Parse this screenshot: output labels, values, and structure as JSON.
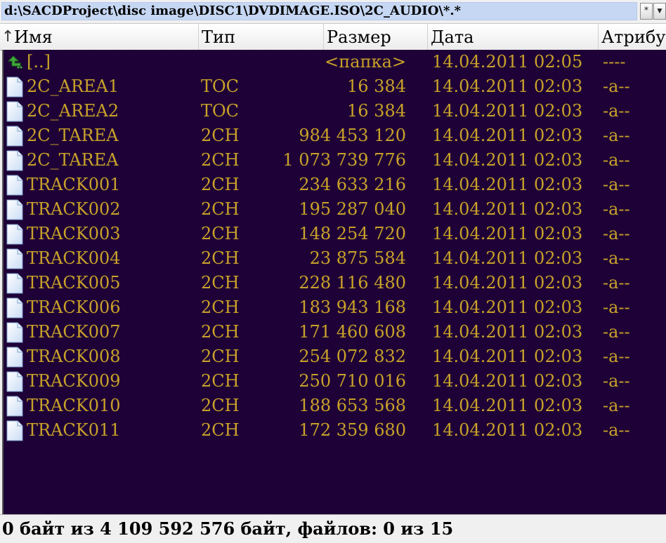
{
  "path": {
    "text": "d:\\SACDProject\\disc image\\DISC1\\DVDIMAGE.ISO\\2C_AUDIO\\*.*",
    "star_label": "*",
    "down_icon": "chevron-down-icon"
  },
  "columns": {
    "name": "Имя",
    "type": "Тип",
    "size": "Размер",
    "date": "Дата",
    "attr": "Атрибуты"
  },
  "colors": {
    "panel_bg": "#1e0136",
    "file_text": "#c8a22a",
    "path_bg": "#c6d7f3"
  },
  "up_row": {
    "name": "[..]",
    "type": "",
    "size": "<папка>",
    "date": "14.04.2011 02:05",
    "attr": "----",
    "icon": "folder-up-arrow-icon"
  },
  "files": [
    {
      "name": "2C_AREA1",
      "type": "TOC",
      "size": "16 384",
      "date": "14.04.2011 02:03",
      "attr": "-a--"
    },
    {
      "name": "2C_AREA2",
      "type": "TOC",
      "size": "16 384",
      "date": "14.04.2011 02:03",
      "attr": "-a--"
    },
    {
      "name": "2C_TAREA",
      "type": "2CH",
      "size": "984 453 120",
      "date": "14.04.2011 02:03",
      "attr": "-a--"
    },
    {
      "name": "2C_TAREA",
      "type": "2CH",
      "size": "1 073 739 776",
      "date": "14.04.2011 02:03",
      "attr": "-a--"
    },
    {
      "name": "TRACK001",
      "type": "2CH",
      "size": "234 633 216",
      "date": "14.04.2011 02:03",
      "attr": "-a--"
    },
    {
      "name": "TRACK002",
      "type": "2CH",
      "size": "195 287 040",
      "date": "14.04.2011 02:03",
      "attr": "-a--"
    },
    {
      "name": "TRACK003",
      "type": "2CH",
      "size": "148 254 720",
      "date": "14.04.2011 02:03",
      "attr": "-a--"
    },
    {
      "name": "TRACK004",
      "type": "2CH",
      "size": "23 875 584",
      "date": "14.04.2011 02:03",
      "attr": "-a--"
    },
    {
      "name": "TRACK005",
      "type": "2CH",
      "size": "228 116 480",
      "date": "14.04.2011 02:03",
      "attr": "-a--"
    },
    {
      "name": "TRACK006",
      "type": "2CH",
      "size": "183 943 168",
      "date": "14.04.2011 02:03",
      "attr": "-a--"
    },
    {
      "name": "TRACK007",
      "type": "2CH",
      "size": "171 460 608",
      "date": "14.04.2011 02:03",
      "attr": "-a--"
    },
    {
      "name": "TRACK008",
      "type": "2CH",
      "size": "254 072 832",
      "date": "14.04.2011 02:03",
      "attr": "-a--"
    },
    {
      "name": "TRACK009",
      "type": "2CH",
      "size": "250 710 016",
      "date": "14.04.2011 02:03",
      "attr": "-a--"
    },
    {
      "name": "TRACK010",
      "type": "2CH",
      "size": "188 653 568",
      "date": "14.04.2011 02:03",
      "attr": "-a--"
    },
    {
      "name": "TRACK011",
      "type": "2CH",
      "size": "172 359 680",
      "date": "14.04.2011 02:03",
      "attr": "-a--"
    }
  ],
  "status": {
    "text": "0 байт из 4 109 592 576 байт, файлов: 0 из 15"
  }
}
